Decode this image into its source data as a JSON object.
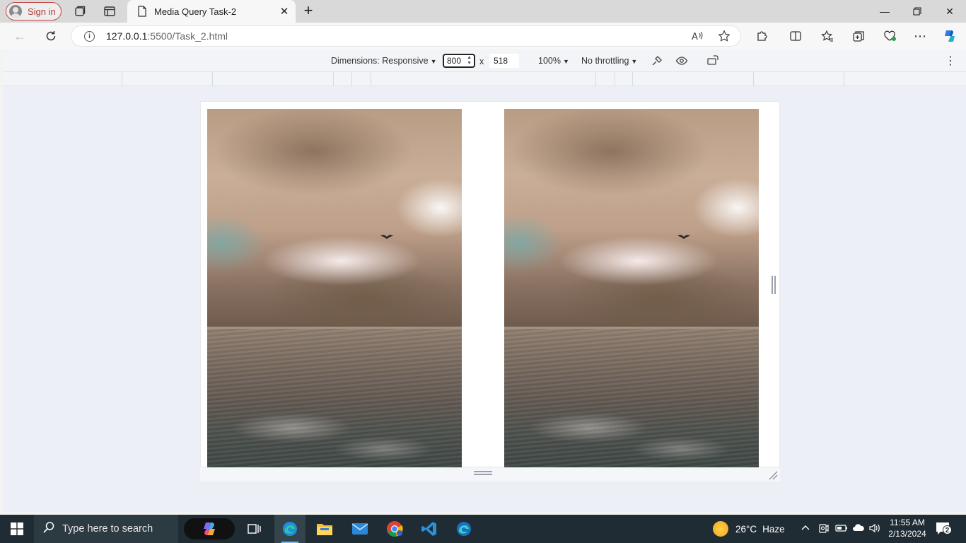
{
  "browser": {
    "sign_in_label": "Sign in",
    "tab_title": "Media Query Task-2",
    "url_host": "127.0.0.1",
    "url_path": ":5500/Task_2.html"
  },
  "devtools": {
    "dimensions_label": "Dimensions: Responsive",
    "width_value": "800",
    "times_label": "x",
    "height_value": "518",
    "zoom_label": "100%",
    "throttling_label": "No throttling"
  },
  "taskbar": {
    "search_placeholder": "Type here to search",
    "weather_temp": "26°C",
    "weather_desc": "Haze",
    "time": "11:55 AM",
    "date": "2/13/2024",
    "notification_count": "2"
  },
  "colors": {
    "accent": "#1a73e8",
    "taskbar": "#1f2c33",
    "signin_border": "#c44a4a"
  }
}
